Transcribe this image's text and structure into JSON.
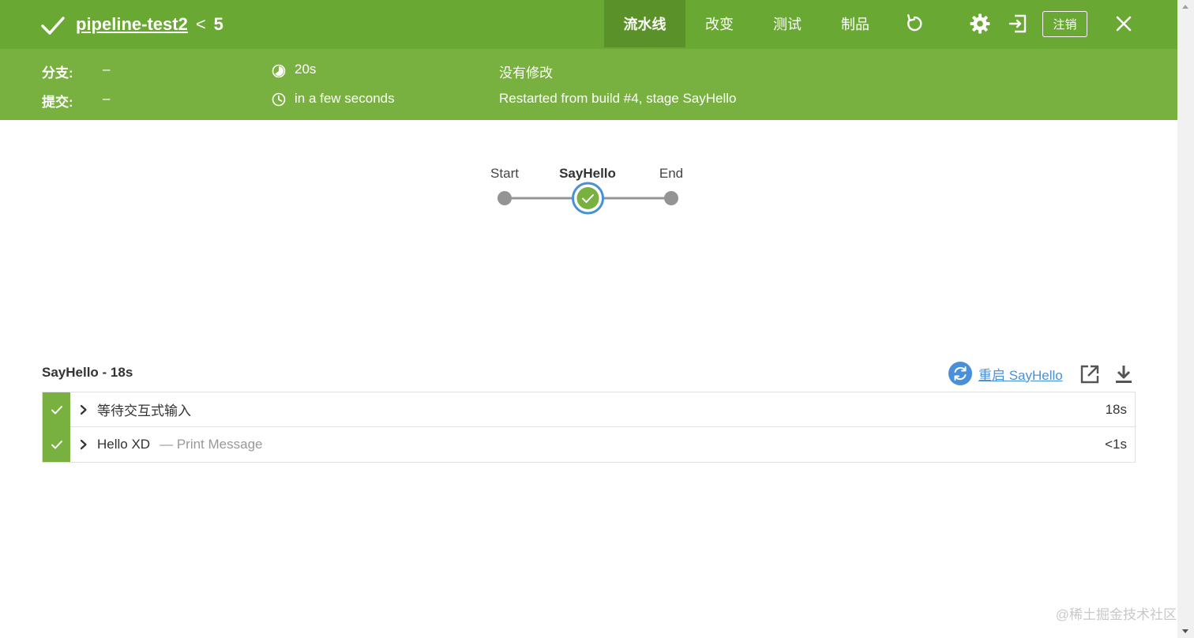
{
  "header": {
    "pipeline_name": "pipeline-test2",
    "separator": "<",
    "build_number": "5",
    "tabs": [
      "流水线",
      "改变",
      "测试",
      "制品"
    ],
    "logout_label": "注销",
    "icons": {
      "status": "check-icon",
      "rerun": "replay-icon",
      "settings": "gear-icon",
      "exit": "exit-icon",
      "close": "close-icon"
    },
    "colors": {
      "bar": "#6aa834",
      "active_tab": "#5a9229",
      "info_strip": "#78b13f"
    }
  },
  "info": {
    "branch_label": "分支:",
    "branch_value": "–",
    "commit_label": "提交:",
    "commit_value": "–",
    "duration": "20s",
    "started": "in a few seconds",
    "changes": "没有修改",
    "cause": "Restarted from build #4, stage SayHello"
  },
  "graph": {
    "stages": [
      "Start",
      "SayHello",
      "End"
    ],
    "selected": "SayHello"
  },
  "panel": {
    "title": "SayHello - 18s",
    "restart_label": "重启 SayHello",
    "steps": [
      {
        "title": "等待交互式输入",
        "desc": "",
        "duration": "18s"
      },
      {
        "title": "Hello XD",
        "desc": "— Print Message",
        "duration": "<1s"
      }
    ]
  },
  "watermark": "@稀土掘金技术社区"
}
